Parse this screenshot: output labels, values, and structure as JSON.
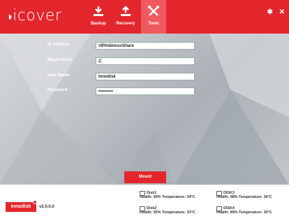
{
  "app": {
    "logo": "icover",
    "nav": [
      {
        "label": "Backup",
        "icon": "download-icon"
      },
      {
        "label": "Recovery",
        "icon": "upload-icon"
      },
      {
        "label": "Tools",
        "icon": "tools-icon",
        "active": true
      }
    ],
    "window_controls": {
      "settings": "✱",
      "close": "✕"
    },
    "colors": {
      "accent": "#e3262c",
      "active_tab": "#ef5a5f"
    }
  },
  "form": {
    "ip_label": "IP Address",
    "ip_value": "\\\\IPAddress\\Share",
    "drive_label": "Mount Drive",
    "drive_value": "Z:",
    "user_label": "User Name",
    "user_value": "Innodisk",
    "password_label": "Password",
    "password_value": "••••••••••"
  },
  "mount_button": "Mount",
  "footer": {
    "brand": "innodisk",
    "version": "v2.0.0.0",
    "disks": [
      {
        "name": "Disk1",
        "stats": "Health: 99% Temperature: 34°C"
      },
      {
        "name": "DISK3",
        "stats": "Health: 98% Temperature: 36°C"
      },
      {
        "name": "Disk2",
        "stats": "Health: 55% Temperature: 33°C"
      },
      {
        "name": "DISK4",
        "stats": "Health: 89% Temperature: 30°C"
      }
    ]
  }
}
